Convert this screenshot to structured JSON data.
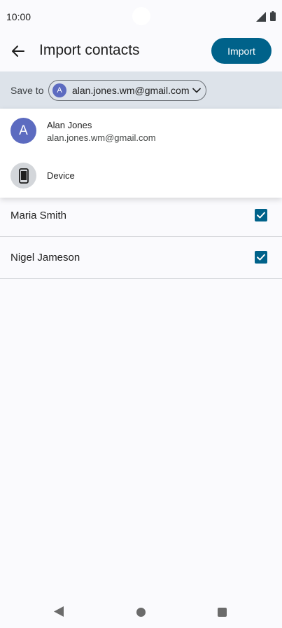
{
  "status_bar": {
    "time": "10:00",
    "icons": [
      "signal-icon",
      "battery-icon"
    ]
  },
  "app_bar": {
    "back_icon": "arrow-left-icon",
    "title": "Import contacts",
    "import_label": "Import"
  },
  "save_to": {
    "label": "Save to",
    "avatar_letter": "A",
    "account_email": "alan.jones.wm@gmail.com",
    "chevron_icon": "chevron-down-icon"
  },
  "dropdown": {
    "items": [
      {
        "avatar_letter": "A",
        "name": "Alan Jones",
        "email": "alan.jones.wm@gmail.com"
      },
      {
        "icon": "phone-device-icon",
        "name": "Device"
      }
    ]
  },
  "contacts": [
    {
      "name": "Maria Smith",
      "checked": true
    },
    {
      "name": "Nigel Jameson",
      "checked": true
    }
  ],
  "colors": {
    "accent": "#00628a",
    "avatar": "#5c6bc0",
    "save_bar_bg": "#dde3ea",
    "background": "#fafafd"
  },
  "nav_bar": {
    "icons": [
      "nav-back-icon",
      "nav-home-icon",
      "nav-recents-icon"
    ]
  }
}
